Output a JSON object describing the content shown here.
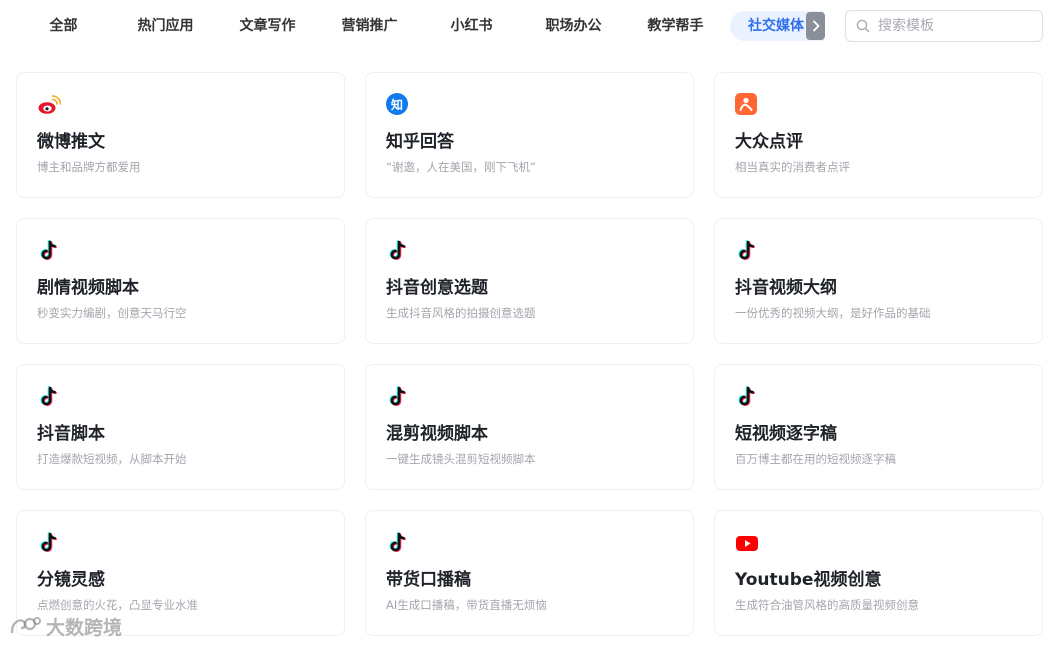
{
  "tabs": [
    {
      "label": "全部"
    },
    {
      "label": "热门应用"
    },
    {
      "label": "文章写作"
    },
    {
      "label": "营销推广"
    },
    {
      "label": "小红书"
    },
    {
      "label": "职场办公"
    },
    {
      "label": "教学帮手"
    },
    {
      "label": "社交媒体",
      "active": true
    }
  ],
  "search": {
    "placeholder": "搜索模板",
    "value": ""
  },
  "colors": {
    "accent": "#2f6fed",
    "weibo": "#e6162d",
    "zhihu": "#0f7aed",
    "dianping": "#ff6633",
    "youtube": "#ff0000"
  },
  "cards": [
    {
      "title": "微博推文",
      "desc": "博主和品牌方都爱用",
      "icon": "weibo-icon"
    },
    {
      "title": "知乎回答",
      "desc": "“谢邀，人在美国，刚下飞机”",
      "icon": "zhihu-icon",
      "icon_text": "知"
    },
    {
      "title": "大众点评",
      "desc": "相当真实的消费者点评",
      "icon": "dianping-icon"
    },
    {
      "title": "剧情视频脚本",
      "desc": "秒变实力编剧，创意天马行空",
      "icon": "douyin-icon"
    },
    {
      "title": "抖音创意选题",
      "desc": "生成抖音风格的拍摄创意选题",
      "icon": "douyin-icon"
    },
    {
      "title": "抖音视频大纲",
      "desc": "一份优秀的视频大纲，是好作品的基础",
      "icon": "douyin-icon"
    },
    {
      "title": "抖音脚本",
      "desc": "打造爆款短视频，从脚本开始",
      "icon": "douyin-icon"
    },
    {
      "title": "混剪视频脚本",
      "desc": "一键生成镜头混剪短视频脚本",
      "icon": "douyin-icon"
    },
    {
      "title": "短视频逐字稿",
      "desc": "百万博主都在用的短视频逐字稿",
      "icon": "douyin-icon"
    },
    {
      "title": "分镜灵感",
      "desc": "点燃创意的火花，凸显专业水准",
      "icon": "douyin-icon"
    },
    {
      "title": "带货口播稿",
      "desc": "AI生成口播稿，带货直播无烦恼",
      "icon": "douyin-icon"
    },
    {
      "title": "Youtube视频创意",
      "desc": "生成符合油管风格的高质量视频创意",
      "icon": "youtube-icon"
    }
  ],
  "watermark": {
    "text": "大数跨境"
  }
}
